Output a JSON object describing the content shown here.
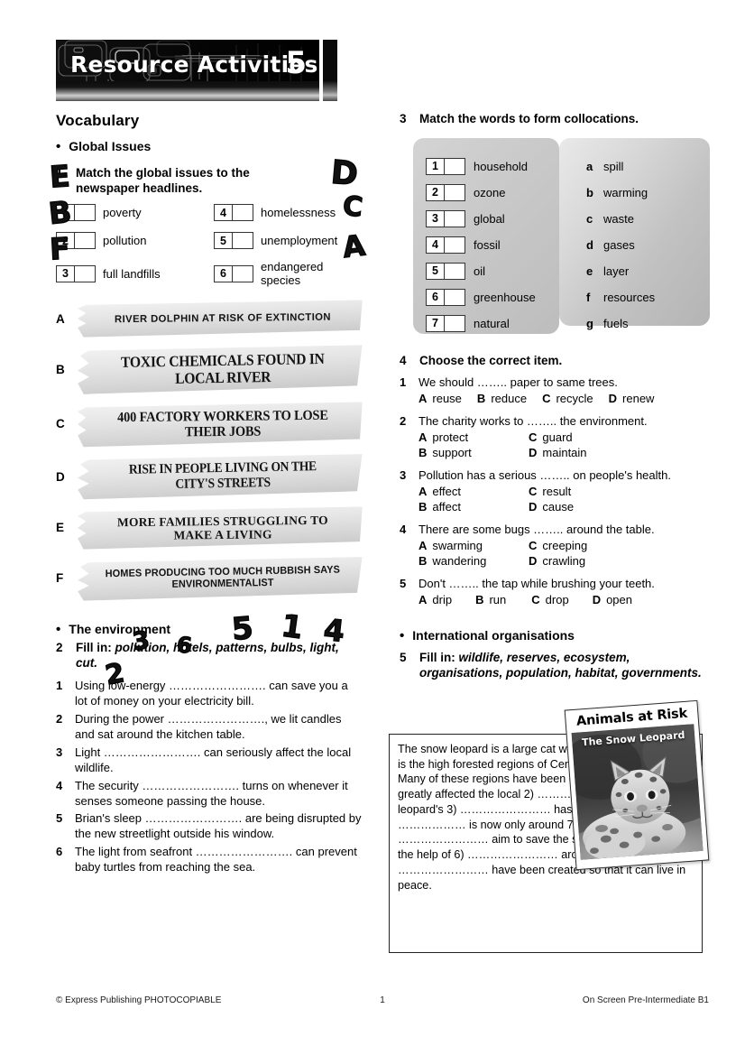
{
  "header": {
    "title": "Resource Activities",
    "unit_number": "5"
  },
  "left": {
    "section_title": "Vocabulary",
    "subsection_global": "Global Issues",
    "ex1": {
      "number": "1",
      "instruction": "Match the global issues to the newspaper headlines.",
      "items": [
        {
          "num": "1",
          "label": "poverty"
        },
        {
          "num": "4",
          "label": "homelessness"
        },
        {
          "num": "2",
          "label": "pollution"
        },
        {
          "num": "5",
          "label": "unemployment"
        },
        {
          "num": "3",
          "label": "full landfills"
        },
        {
          "num": "6",
          "label": "endangered species"
        }
      ],
      "scribbles": [
        "E",
        "B",
        "F",
        "D",
        "C",
        "A"
      ]
    },
    "headlines": [
      {
        "letter": "A",
        "text": "RIVER DOLPHIN AT RISK OF EXTINCTION"
      },
      {
        "letter": "B",
        "text": "TOXIC CHEMICALS FOUND IN LOCAL RIVER"
      },
      {
        "letter": "C",
        "text": "400 FACTORY WORKERS TO LOSE THEIR JOBS"
      },
      {
        "letter": "D",
        "text": "RISE IN PEOPLE LIVING ON THE CITY'S STREETS"
      },
      {
        "letter": "E",
        "text": "MORE FAMILIES STRUGGLING TO MAKE A LIVING"
      },
      {
        "letter": "F",
        "text": "HOMES PRODUCING TOO MUCH RUBBISH SAYS ENVIRONMENTALIST"
      }
    ],
    "subsection_env": "The environment",
    "ex2": {
      "number": "2",
      "label": "Fill in:",
      "words": "pollution, hotels, patterns, bulbs, light, cut.",
      "scribbles": [
        "3",
        "6",
        "5",
        "1",
        "4",
        "2"
      ],
      "questions": [
        {
          "num": "1",
          "text": "Using low-energy ……………………. can save you a lot of money on your electricity bill."
        },
        {
          "num": "2",
          "text": "During the power ……………………., we lit candles and sat around the kitchen table."
        },
        {
          "num": "3",
          "text": "Light ……………………. can seriously affect the local wildlife."
        },
        {
          "num": "4",
          "text": "The security ……………………. turns on whenever it senses someone passing the house."
        },
        {
          "num": "5",
          "text": "Brian's sleep ……………………. are being disrupted by the new streetlight outside his window."
        },
        {
          "num": "6",
          "text": "The light from seafront ……………………. can prevent baby turtles from reaching the sea."
        }
      ]
    }
  },
  "right": {
    "ex3": {
      "number": "3",
      "instruction": "Match the words to form collocations.",
      "left_items": [
        {
          "num": "1",
          "label": "household"
        },
        {
          "num": "2",
          "label": "ozone"
        },
        {
          "num": "3",
          "label": "global"
        },
        {
          "num": "4",
          "label": "fossil"
        },
        {
          "num": "5",
          "label": "oil"
        },
        {
          "num": "6",
          "label": "greenhouse"
        },
        {
          "num": "7",
          "label": "natural"
        }
      ],
      "right_items": [
        {
          "letter": "a",
          "label": "spill"
        },
        {
          "letter": "b",
          "label": "warming"
        },
        {
          "letter": "c",
          "label": "waste"
        },
        {
          "letter": "d",
          "label": "gases"
        },
        {
          "letter": "e",
          "label": "layer"
        },
        {
          "letter": "f",
          "label": "resources"
        },
        {
          "letter": "g",
          "label": "fuels"
        }
      ]
    },
    "ex4": {
      "number": "4",
      "instruction": "Choose the correct item.",
      "questions": [
        {
          "num": "1",
          "stem": "We should …….. paper to same trees.",
          "layout": "inline",
          "options": [
            {
              "letter": "A",
              "text": "reuse"
            },
            {
              "letter": "B",
              "text": "reduce"
            },
            {
              "letter": "C",
              "text": "recycle"
            },
            {
              "letter": "D",
              "text": "renew"
            }
          ]
        },
        {
          "num": "2",
          "stem": "The charity works to …….. the environment.",
          "layout": "grid",
          "options": [
            {
              "letter": "A",
              "text": "protect"
            },
            {
              "letter": "C",
              "text": "guard"
            },
            {
              "letter": "B",
              "text": "support"
            },
            {
              "letter": "D",
              "text": "maintain"
            }
          ]
        },
        {
          "num": "3",
          "stem": "Pollution has a serious …….. on people's health.",
          "layout": "grid",
          "options": [
            {
              "letter": "A",
              "text": "effect"
            },
            {
              "letter": "C",
              "text": "result"
            },
            {
              "letter": "B",
              "text": "affect"
            },
            {
              "letter": "D",
              "text": "cause"
            }
          ]
        },
        {
          "num": "4",
          "stem": "There are some bugs …….. around the table.",
          "layout": "grid",
          "options": [
            {
              "letter": "A",
              "text": "swarming"
            },
            {
              "letter": "C",
              "text": "creeping"
            },
            {
              "letter": "B",
              "text": "wandering"
            },
            {
              "letter": "D",
              "text": "crawling"
            }
          ]
        },
        {
          "num": "5",
          "stem": "Don't …….. the tap while brushing your teeth.",
          "layout": "inline",
          "options": [
            {
              "letter": "A",
              "text": "drip"
            },
            {
              "letter": "B",
              "text": "run"
            },
            {
              "letter": "C",
              "text": "drop"
            },
            {
              "letter": "D",
              "text": "open"
            }
          ]
        }
      ]
    },
    "subsection_intl": "International organisations",
    "ex5": {
      "number": "5",
      "label": "Fill in:",
      "words": "wildlife, reserves, ecosystem, organisations, population, habitat, governments."
    },
    "reading": {
      "text": "The snow leopard is a large cat whose natural 1) ……….. is the high forested regions of Central and South Asia. Many of these regions have been developed, which has greatly affected the local 2) ………… . Because the snow leopard's 3) …………………… has been destroyed, its 4) ……………… is now only around 7,000. Conservation 5) …………………… aim to save the snow leopard and, with the help of 6) …………………… around Asia, nature 7) …………………… have been created so that it can live in peace.",
      "card_title": "Animals at Risk",
      "card_subtitle": "The Snow Leopard"
    }
  },
  "footer": {
    "left": "© Express Publishing PHOTOCOPIABLE",
    "page": "1",
    "right": "On Screen Pre-Intermediate B1"
  }
}
